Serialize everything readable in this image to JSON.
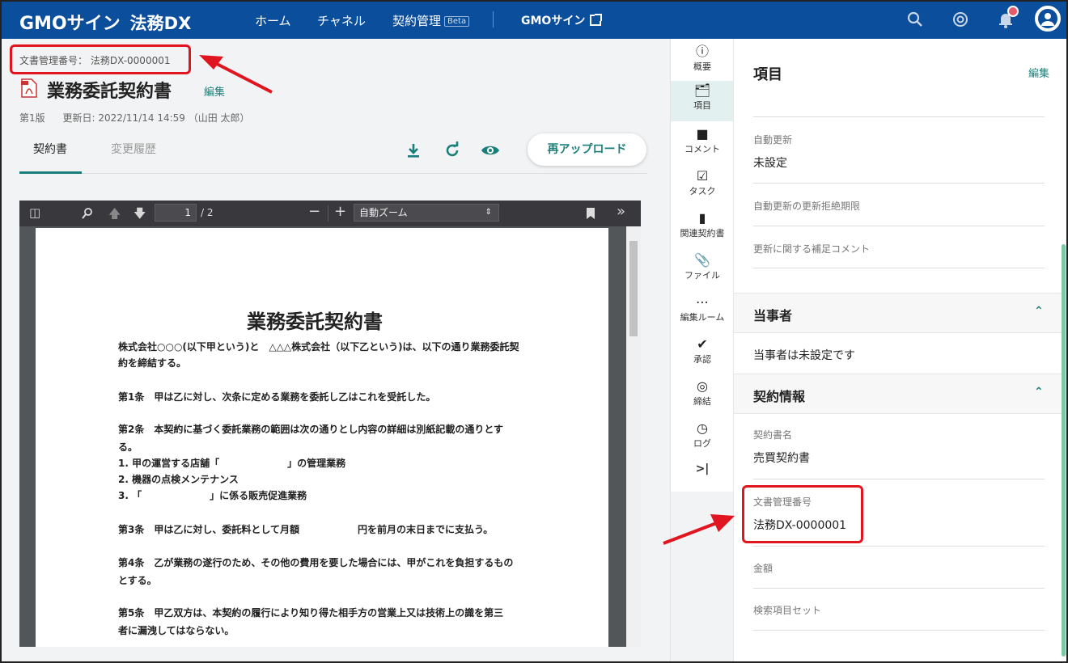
{
  "topbar": {
    "logo": "GMOサイン",
    "product": "法務DX",
    "nav": [
      "ホーム",
      "チャネル",
      "契約管理"
    ],
    "beta": "Beta",
    "external": "GMOサイン"
  },
  "doc": {
    "number_label": "文書管理番号：",
    "number_value": "法務DX-0000001",
    "title": "業務委託契約書",
    "edit": "編集",
    "version": "第1版",
    "updated_label": "更新日:",
    "updated_value": "2022/11/14 14:59",
    "updated_by": "（山田 太郎）"
  },
  "tabs": [
    "契約書",
    "変更履歴"
  ],
  "actions": {
    "reupload": "再アップロード"
  },
  "viewer": {
    "page_current": "1",
    "page_total": "/ 2",
    "zoom": "自動ズーム"
  },
  "page_content": {
    "title": "業務委託契約書",
    "lines": [
      "株式会社○○○(以下甲という)と　△△△株式会社（以下乙という)は、以下の通り業務委託契",
      "約を締結する。",
      "第1条　甲は乙に対し、次条に定める業務を委託し乙はこれを受託した。",
      "第2条　本契約に基づく委託業務の範囲は次の通りとし内容の詳細は別紙記載の通りとす",
      "る。",
      "1. 甲の運営する店舗「　　　　　　　」の管理業務",
      "2. 機器の点検メンテナンス",
      "3. 「　　　　　　　」に係る販売促進業務",
      "第3条　甲は乙に対し、委託料として月額　　　　　　円を前月の末日までに支払う。",
      "第4条　乙が業務の遂行のため、その他の費用を要した場合には、甲がこれを負担するもの",
      "とする。",
      "第5条　甲乙双方は、本契約の履行により知り得た相手方の営業上又は技術上の識を第三",
      "者に漏洩してはならない。"
    ]
  },
  "rail": [
    "概要",
    "項目",
    "コメント",
    "タスク",
    "関連契約書",
    "ファイル",
    "編集ルーム",
    "承認",
    "締結",
    "ログ"
  ],
  "panel": {
    "title": "項目",
    "edit": "編集",
    "fields_top": [
      {
        "label": "自動更新",
        "value": "未設定"
      },
      {
        "label": "自動更新の更新拒絶期限",
        "value": ""
      },
      {
        "label": "更新に関する補足コメント",
        "value": ""
      }
    ],
    "section_parties": "当事者",
    "parties_empty": "当事者は未設定です",
    "section_contract": "契約情報",
    "fields_contract": [
      {
        "label": "契約書名",
        "value": "売買契約書"
      },
      {
        "label": "文書管理番号",
        "value": "法務DX-0000001"
      },
      {
        "label": "金額",
        "value": ""
      },
      {
        "label": "検索項目セット",
        "value": ""
      }
    ]
  },
  "colors": {
    "brand": "#0b4e9b",
    "accent": "#1a7f7a",
    "highlight": "#e0151f"
  }
}
